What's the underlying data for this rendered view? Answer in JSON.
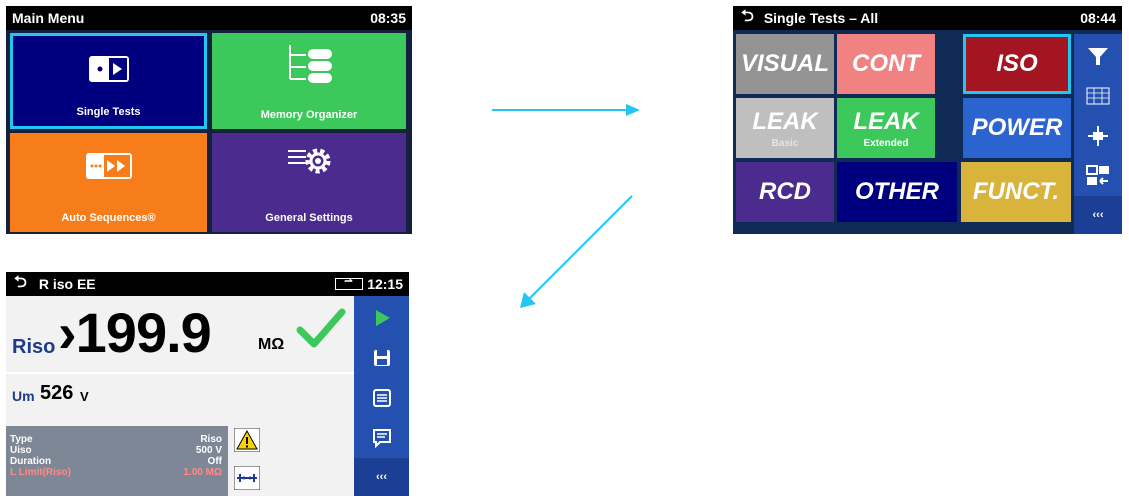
{
  "main_menu": {
    "title": "Main Menu",
    "clock": "08:35",
    "tiles": [
      {
        "label": "Single Tests",
        "icon": "single-tests-icon"
      },
      {
        "label": "Memory Organizer",
        "icon": "memory-organizer-icon"
      },
      {
        "label": "Auto Sequences®",
        "icon": "auto-sequences-icon"
      },
      {
        "label": "General Settings",
        "icon": "general-settings-icon"
      }
    ]
  },
  "single_tests": {
    "title": "Single Tests – All",
    "clock": "08:44",
    "tests": [
      {
        "label": "VISUAL",
        "sub": ""
      },
      {
        "label": "CONT",
        "sub": ""
      },
      {
        "label": "ISO",
        "sub": ""
      },
      {
        "label": "LEAK",
        "sub": "Basic"
      },
      {
        "label": "LEAK",
        "sub": "Extended"
      },
      {
        "label": "POWER",
        "sub": ""
      },
      {
        "label": "RCD",
        "sub": ""
      },
      {
        "label": "OTHER",
        "sub": ""
      },
      {
        "label": "FUNCT.",
        "sub": ""
      }
    ],
    "sidebar": [
      "filter-icon",
      "grid-view-icon",
      "move-icon",
      "swap-view-icon",
      "more-icon"
    ],
    "more_label": "‹‹‹"
  },
  "riso": {
    "title": "R iso EE",
    "clock": "12:15",
    "result_label": "Riso",
    "result_value": "›199.9",
    "result_unit": "MΩ",
    "um_label": "Um",
    "um_value": "526",
    "um_unit": "V",
    "params": [
      {
        "name": "Type",
        "value": "Riso"
      },
      {
        "name": "Uiso",
        "value": "500 V"
      },
      {
        "name": "Duration",
        "value": "Off"
      },
      {
        "name": "L Limit(Riso)",
        "value": "1.00 MΩ"
      }
    ],
    "more_label": "‹‹‹"
  },
  "colors": {
    "accent": "#21c6f2",
    "dark_blue": "#00007f",
    "green": "#3cc85b",
    "orange": "#f77d1b",
    "purple": "#4b2b8e"
  }
}
